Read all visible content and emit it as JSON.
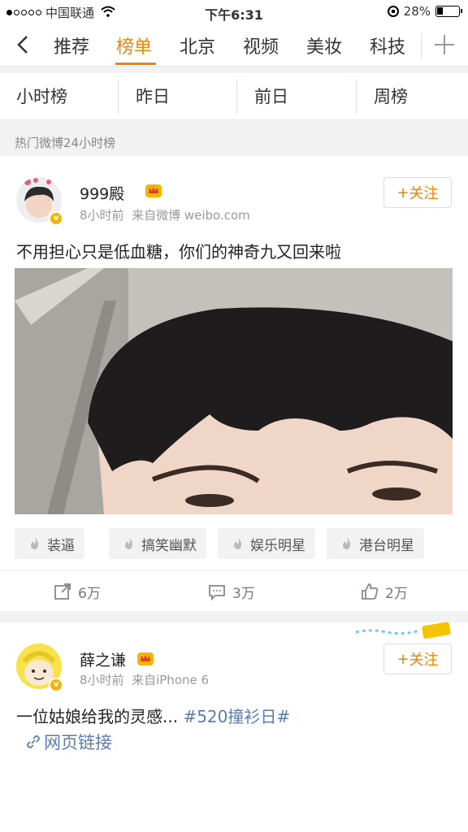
{
  "status_bar": {
    "carrier": "中国联通",
    "time": "下午6:31",
    "battery": "28%",
    "battery_level": 0.28
  },
  "nav": {
    "back_icon": "chevron-left-icon",
    "tabs": [
      "推荐",
      "榜单",
      "北京",
      "视频",
      "美妆",
      "科技"
    ],
    "active_tab": "榜单",
    "plus_icon": "plus-icon",
    "accent": "#f28200"
  },
  "subtabs": [
    "小时榜",
    "昨日",
    "前日",
    "周榜"
  ],
  "section_label": "热门微博24小时榜",
  "posts": [
    {
      "username": "999殿",
      "time": "8小时前",
      "source": "来自微博 weibo.com",
      "follow_label": "关注",
      "text": "不用担心只是低血糖，你们的神奇九又回来啦",
      "topics": [
        "装逼",
        "搞笑幽默",
        "娱乐明星",
        "港台明星"
      ],
      "actions": {
        "repost": "6万",
        "comment": "3万",
        "like": "2万"
      }
    },
    {
      "username": "薛之谦",
      "time": "8小时前",
      "source": "来自iPhone 6",
      "follow_label": "关注",
      "text": "一位姑娘给我的灵感...",
      "hashtag": "#520撞衫日#",
      "link_label": "网页链接"
    }
  ],
  "colors": {
    "accent": "#f28200",
    "link": "#5a7bb5",
    "verified": "#f5b400"
  }
}
